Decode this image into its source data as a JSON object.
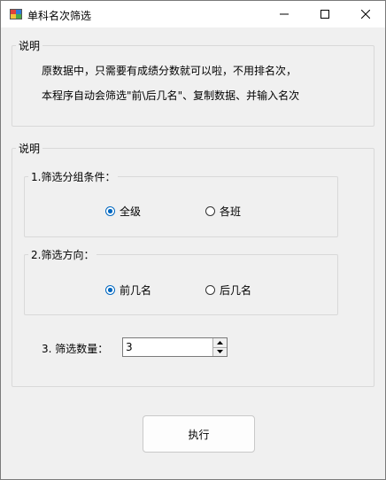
{
  "window": {
    "title": "单科名次筛选"
  },
  "info_group": {
    "legend": "说明",
    "line1": "原数据中，只需要有成绩分数就可以啦，不用排名次，",
    "line2": "本程序自动会筛选\"前\\后几名\"、复制数据、并输入名次"
  },
  "options_group": {
    "legend": "说明",
    "group_by": {
      "legend": "1.筛选分组条件：",
      "options": [
        {
          "label": "全级",
          "checked": true
        },
        {
          "label": "各班",
          "checked": false
        }
      ]
    },
    "direction": {
      "legend": "2.筛选方向：",
      "options": [
        {
          "label": "前几名",
          "checked": true
        },
        {
          "label": "后几名",
          "checked": false
        }
      ]
    },
    "count": {
      "label": "3. 筛选数量：",
      "value": "3"
    }
  },
  "execute_button": "执行",
  "colors": {
    "accent": "#0067c0"
  },
  "icons": [
    "app-icon",
    "minimize-icon",
    "maximize-icon",
    "close-icon",
    "radio-icon",
    "spin-up-icon",
    "spin-down-icon"
  ]
}
